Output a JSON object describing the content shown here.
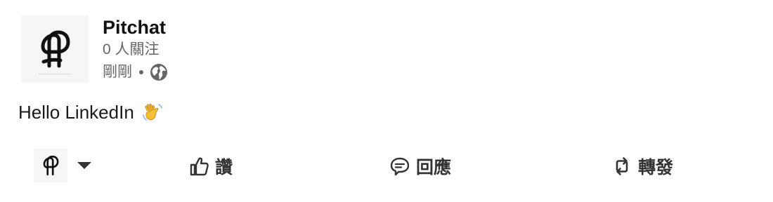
{
  "post": {
    "author": {
      "name": "Pitchat",
      "followers": "0 人關注",
      "timestamp": "剛剛",
      "visibility_icon": "globe-icon",
      "logo_icon": "pitchat-logo"
    },
    "text": "Hello LinkedIn",
    "emoji_icon": "waving-hand-icon"
  },
  "actions": {
    "actor_icon": "pitchat-logo",
    "actor_dropdown_icon": "caret-down-icon",
    "like_label": "讚",
    "comment_label": "回應",
    "repost_label": "轉發"
  },
  "colors": {
    "text_primary": "#1a1a1a",
    "text_secondary": "#666666",
    "action_text": "#333333",
    "logo_bg": "#f6f7f4",
    "wave_yellow": "#f5c033"
  }
}
